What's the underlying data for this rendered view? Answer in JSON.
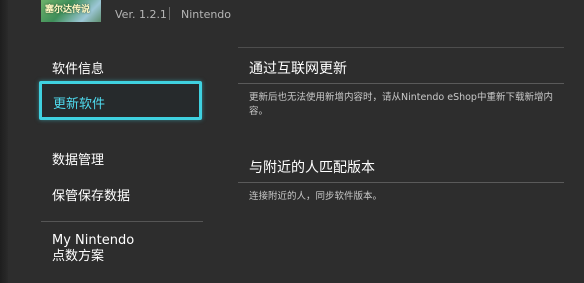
{
  "header": {
    "game_title_art_text": "塞尔达传说",
    "version": "Ver. 1.2.1",
    "publisher": "Nintendo"
  },
  "sidebar": {
    "items": [
      {
        "label": "软件信息"
      },
      {
        "label": "更新软件",
        "selected": true
      },
      {
        "label": "数据管理"
      },
      {
        "label": "保管保存数据"
      },
      {
        "label": "My Nintendo\n点数方案"
      }
    ],
    "my_nintendo_line1": "My Nintendo",
    "my_nintendo_line2": "点数方案"
  },
  "main": {
    "sections": [
      {
        "title": "通过互联网更新",
        "description": "更新后也无法使用新增内容时，请从Nintendo eShop中重新下载新增内容。"
      },
      {
        "title": "与附近的人匹配版本",
        "description": "连接附近的人，同步软件版本。"
      }
    ]
  },
  "colors": {
    "background": "#2d2d2d",
    "selection_accent": "#3fd1e0",
    "text_primary": "#ffffff",
    "text_secondary": "#c9c9c9"
  }
}
